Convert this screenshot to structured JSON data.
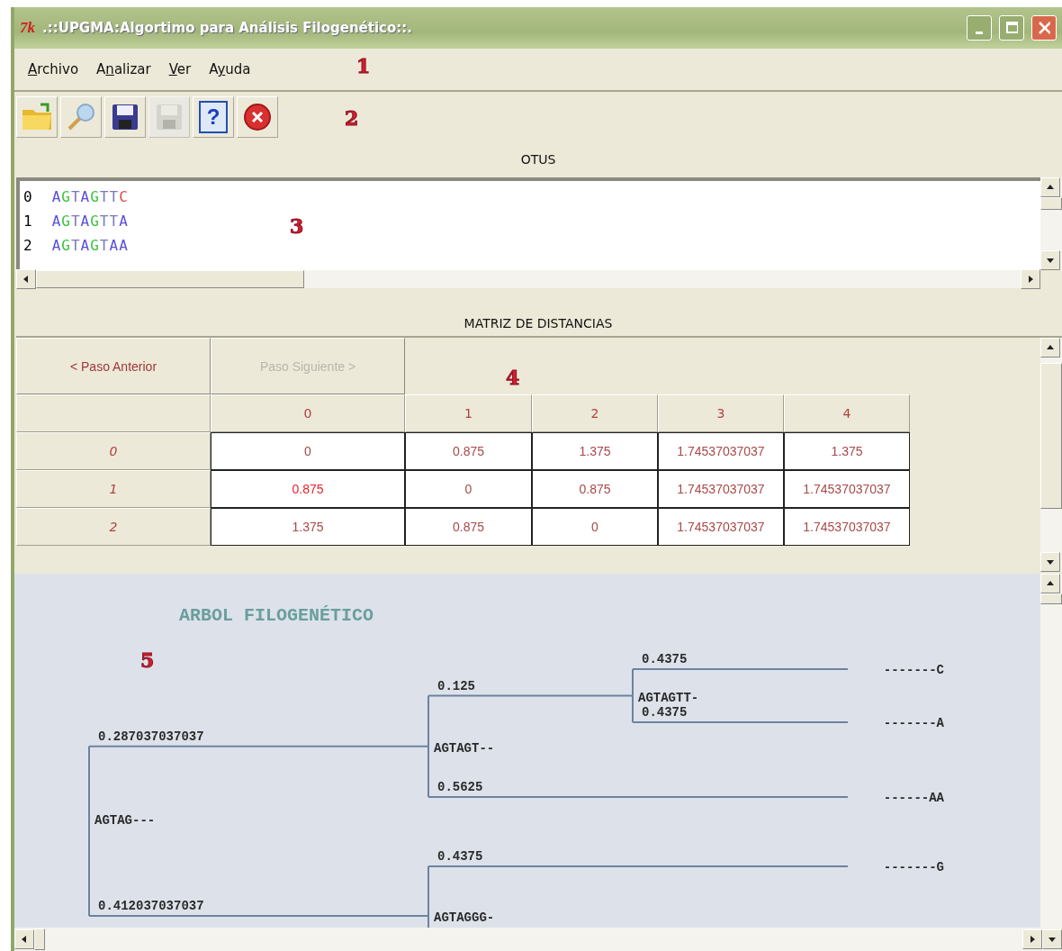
{
  "window": {
    "app_icon": "7k",
    "title": ".::UPGMA:Algortimo para Análisis Filogenético::."
  },
  "menu_bar": {
    "callout": "1",
    "items": [
      {
        "key": "A",
        "after": "rchivo"
      },
      {
        "before": "A",
        "key": "n",
        "after": "alizar"
      },
      {
        "key": "V",
        "after": "er"
      },
      {
        "before": "A",
        "key": "y",
        "after": "uda"
      }
    ]
  },
  "toolbar": {
    "callout": "2",
    "items": [
      {
        "kind": "open",
        "disabled": false
      },
      {
        "kind": "search",
        "disabled": false
      },
      {
        "kind": "save",
        "disabled": false
      },
      {
        "kind": "save",
        "disabled": true
      },
      {
        "kind": "help",
        "glyph": "?",
        "disabled": false
      },
      {
        "kind": "close",
        "disabled": false
      }
    ]
  },
  "otus": {
    "title": "OTUS",
    "callout": "3",
    "rows": [
      {
        "index": "0",
        "bases": [
          {
            "t": "A",
            "color": "#5a50d8"
          },
          {
            "t": "G",
            "color": "#3cc43c"
          },
          {
            "t": "T",
            "color": "#7a78b8"
          },
          {
            "t": "A",
            "color": "#5a50d8"
          },
          {
            "t": "G",
            "color": "#3cc43c"
          },
          {
            "t": "T",
            "color": "#7a78b8"
          },
          {
            "t": "T",
            "color": "#7a78b8"
          },
          {
            "t": "C",
            "color": "#e04848"
          }
        ]
      },
      {
        "index": "1",
        "bases": [
          {
            "t": "A",
            "color": "#5a50d8"
          },
          {
            "t": "G",
            "color": "#3cc43c"
          },
          {
            "t": "T",
            "color": "#7a78b8"
          },
          {
            "t": "A",
            "color": "#5a50d8"
          },
          {
            "t": "G",
            "color": "#3cc43c"
          },
          {
            "t": "T",
            "color": "#7a78b8"
          },
          {
            "t": "T",
            "color": "#7a78b8"
          },
          {
            "t": "A",
            "color": "#5a50d8"
          }
        ]
      },
      {
        "index": "2",
        "bases": [
          {
            "t": "A",
            "color": "#5a50d8"
          },
          {
            "t": "G",
            "color": "#3cc43c"
          },
          {
            "t": "T",
            "color": "#7a78b8"
          },
          {
            "t": "A",
            "color": "#5a50d8"
          },
          {
            "t": "G",
            "color": "#3cc43c"
          },
          {
            "t": "T",
            "color": "#7a78b8"
          },
          {
            "t": "A",
            "color": "#5a50d8"
          },
          {
            "t": "A",
            "color": "#5a50d8"
          }
        ]
      }
    ]
  },
  "matrix": {
    "title": "MATRIZ DE DISTANCIAS",
    "callout": "4",
    "buttons": [
      {
        "label": "< Paso Anterior",
        "disabled": false
      },
      {
        "label": "Paso Siguiente >",
        "disabled": true
      }
    ],
    "columns": [
      "0",
      "1",
      "2",
      "3",
      "4"
    ],
    "rows": [
      {
        "header": "0",
        "cells": [
          {
            "text": "0",
            "highlighted": false
          },
          {
            "text": "0.875",
            "highlighted": false
          },
          {
            "text": "1.375",
            "highlighted": false
          },
          {
            "text": "1.74537037037",
            "highlighted": false
          },
          {
            "text": "1.375",
            "highlighted": false
          }
        ]
      },
      {
        "header": "1",
        "cells": [
          {
            "text": "0.875",
            "highlighted": true
          },
          {
            "text": "0",
            "highlighted": false
          },
          {
            "text": "0.875",
            "highlighted": false
          },
          {
            "text": "1.74537037037",
            "highlighted": false
          },
          {
            "text": "1.74537037037",
            "highlighted": false
          }
        ]
      },
      {
        "header": "2",
        "cells": [
          {
            "text": "1.375",
            "highlighted": false
          },
          {
            "text": "0.875",
            "highlighted": false
          },
          {
            "text": "0",
            "highlighted": false
          },
          {
            "text": "1.74537037037",
            "highlighted": false
          },
          {
            "text": "1.74537037037",
            "highlighted": false
          }
        ]
      }
    ]
  },
  "tree": {
    "title": "ARBOL FILOGENÉTICO",
    "callout": "5",
    "root": {
      "label": "AGTAG---",
      "children": [
        {
          "length": "0.287037037037",
          "label": "AGTAGT--",
          "children": [
            {
              "length": "0.125",
              "label": "AGTAGTT-",
              "children": [
                {
                  "length": "0.4375",
                  "leaf": "-------C"
                },
                {
                  "length": "0.4375",
                  "leaf": "-------A"
                }
              ]
            },
            {
              "length": "0.5625",
              "leaf": "------AA"
            }
          ]
        },
        {
          "length": "0.412037037037",
          "label": "AGTAGGG-",
          "children": [
            {
              "length": "0.4375",
              "leaf": "-------G"
            }
          ]
        }
      ]
    }
  }
}
